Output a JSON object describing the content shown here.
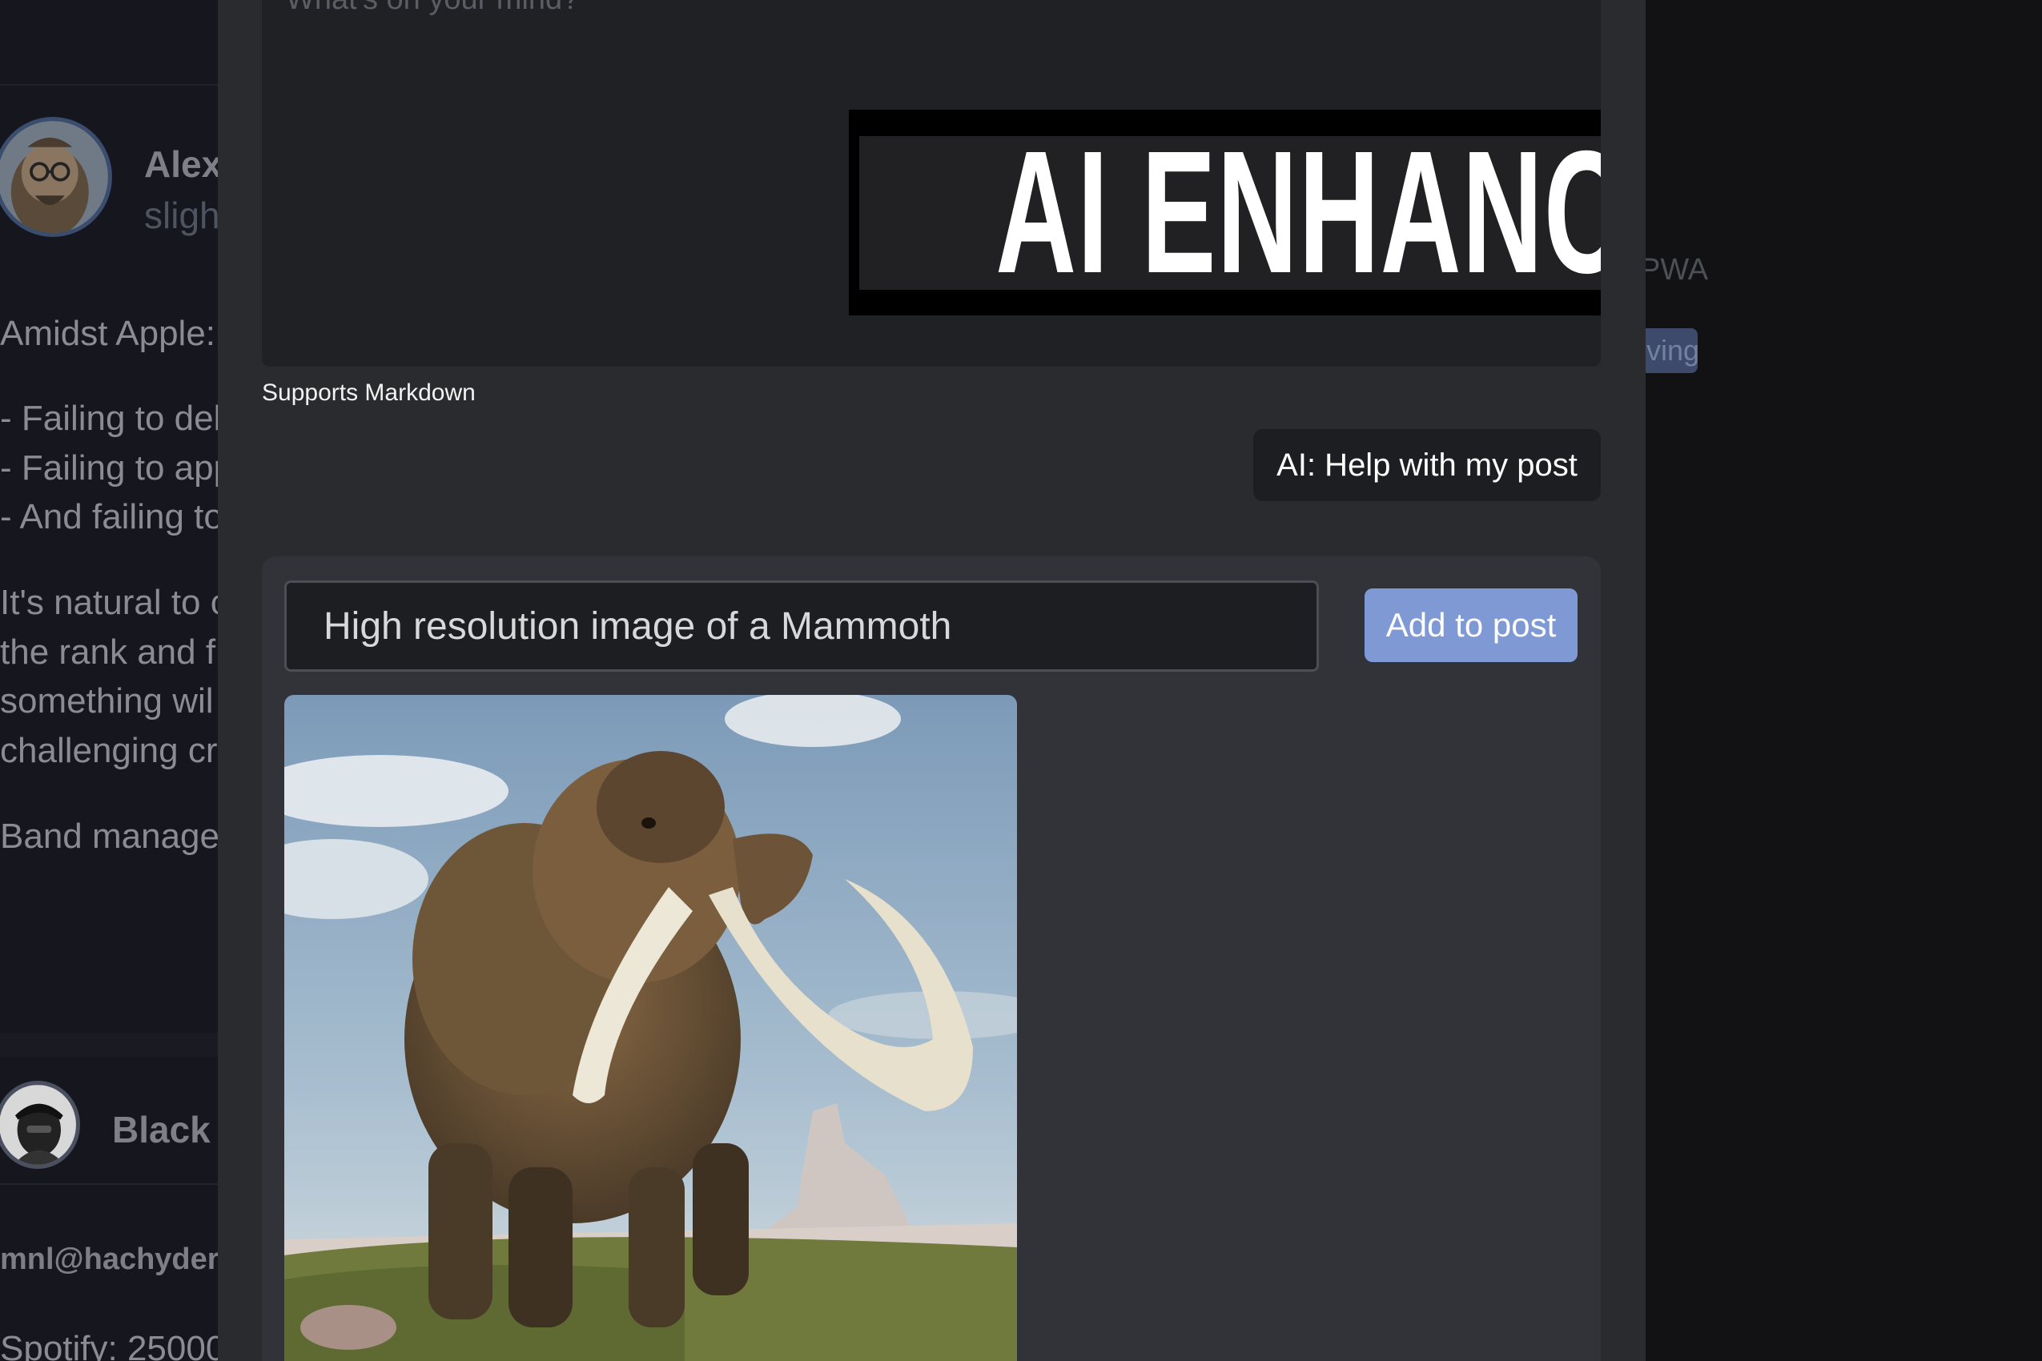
{
  "feed": {
    "post1": {
      "name": "Alex",
      "handle": "sligh",
      "lines": [
        "Amidst Apple:",
        "- Failing to del",
        "- Failing to app",
        "- And failing to",
        "It's natural to c",
        "the rank and fi",
        "something wil",
        "challenging cr",
        "Band manager"
      ]
    },
    "post2": {
      "name": "Black",
      "mention": "mnl@hachyderm",
      "spotify": "Spotify: 25000"
    }
  },
  "right_panel": {
    "pwa_text": "PWA",
    "chip_text": "ving"
  },
  "composer": {
    "placeholder": "What's on your mind?",
    "banner_text": "AI ENHANCED",
    "markdown_hint": "Supports Markdown",
    "ai_help_label": "AI: Help with my post"
  },
  "ai_image_panel": {
    "prompt_value": "High resolution image of a Mammoth",
    "add_button_label": "Add to post",
    "image_icon": "mammoth-image"
  },
  "colors": {
    "modal_bg": "#2a2b2f",
    "editor_bg": "#202124",
    "accent_button": "#7e99d3",
    "panel_bg": "#323338"
  }
}
